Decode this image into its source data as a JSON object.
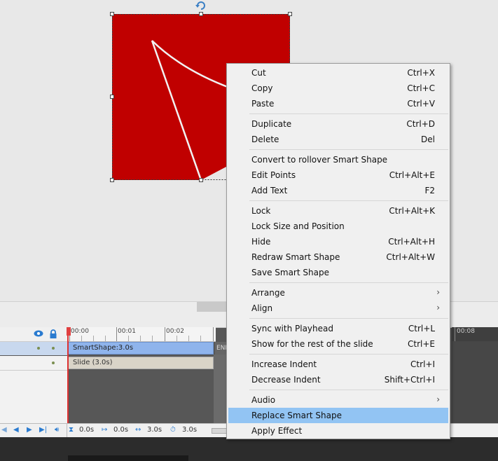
{
  "timeline": {
    "ruler_labels": [
      "00:00",
      "00:01",
      "00:02",
      "00:08"
    ],
    "end_label": "END",
    "rows": [
      {
        "bar_label": "SmartShape:3.0s"
      },
      {
        "bar_label": "Slide (3.0s)"
      }
    ],
    "controls": {
      "time_current": "0.0s",
      "time_start": "0.0s",
      "time_duration": "3.0s",
      "time_total": "3.0s"
    }
  },
  "context_menu": {
    "groups": [
      [
        {
          "label": "Cut",
          "shortcut": "Ctrl+X"
        },
        {
          "label": "Copy",
          "shortcut": "Ctrl+C"
        },
        {
          "label": "Paste",
          "shortcut": "Ctrl+V"
        }
      ],
      [
        {
          "label": "Duplicate",
          "shortcut": "Ctrl+D"
        },
        {
          "label": "Delete",
          "shortcut": "Del"
        }
      ],
      [
        {
          "label": "Convert to rollover Smart Shape",
          "shortcut": ""
        },
        {
          "label": "Edit Points",
          "shortcut": "Ctrl+Alt+E"
        },
        {
          "label": "Add Text",
          "shortcut": "F2"
        }
      ],
      [
        {
          "label": "Lock",
          "shortcut": "Ctrl+Alt+K"
        },
        {
          "label": "Lock Size and Position",
          "shortcut": ""
        },
        {
          "label": "Hide",
          "shortcut": "Ctrl+Alt+H"
        },
        {
          "label": "Redraw Smart Shape",
          "shortcut": "Ctrl+Alt+W"
        },
        {
          "label": "Save Smart Shape",
          "shortcut": ""
        }
      ],
      [
        {
          "label": "Arrange",
          "submenu": true
        },
        {
          "label": "Align",
          "submenu": true
        }
      ],
      [
        {
          "label": "Sync with Playhead",
          "shortcut": "Ctrl+L"
        },
        {
          "label": "Show for the rest of the slide",
          "shortcut": "Ctrl+E"
        }
      ],
      [
        {
          "label": "Increase Indent",
          "shortcut": "Ctrl+I"
        },
        {
          "label": "Decrease Indent",
          "shortcut": "Shift+Ctrl+I"
        }
      ],
      [
        {
          "label": "Audio",
          "submenu": true
        },
        {
          "label": "Replace Smart Shape",
          "shortcut": "",
          "highlighted": true
        },
        {
          "label": "Apply Effect",
          "shortcut": ""
        }
      ]
    ]
  },
  "colors": {
    "shape_fill": "#c00000",
    "menu_highlight": "#92c4f3",
    "smartshape_bar": "#8fb4ec",
    "playhead": "#dd3333"
  },
  "icons": [
    "rotate-icon",
    "eye-icon",
    "lock-icon",
    "rewind-icon",
    "play-icon",
    "end-icon",
    "audio-icon",
    "hourglass-icon",
    "start-icon",
    "duration-icon",
    "stopwatch-icon",
    "submenu-arrow-icon"
  ]
}
